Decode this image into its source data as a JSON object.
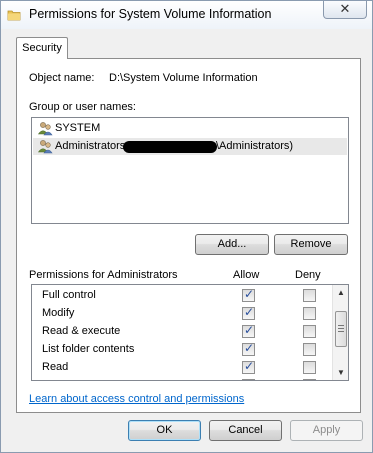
{
  "window": {
    "title": "Permissions for System Volume Information",
    "close_glyph": "✕"
  },
  "tabs": [
    {
      "label": "Security"
    }
  ],
  "object": {
    "label": "Object name:",
    "value": "D:\\System Volume Information"
  },
  "groups": {
    "label": "Group or user names:",
    "items": [
      {
        "name": "SYSTEM",
        "icon": "users-icon"
      },
      {
        "name": "Administrators (",
        "suffix": "\\Administrators)",
        "redacted": true,
        "icon": "users-icon"
      }
    ],
    "add_label": "Add...",
    "remove_label": "Remove"
  },
  "permissions": {
    "label": "Permissions for Administrators",
    "allow_label": "Allow",
    "deny_label": "Deny",
    "rows": [
      {
        "name": "Full control",
        "allow": true,
        "deny": false
      },
      {
        "name": "Modify",
        "allow": true,
        "deny": false
      },
      {
        "name": "Read & execute",
        "allow": true,
        "deny": false
      },
      {
        "name": "List folder contents",
        "allow": true,
        "deny": false
      },
      {
        "name": "Read",
        "allow": true,
        "deny": false
      }
    ]
  },
  "link": "Learn about access control and permissions",
  "buttons": {
    "ok": "OK",
    "cancel": "Cancel",
    "apply": "Apply"
  },
  "colors": {
    "link": "#0066cc",
    "selection": "#e8e8e8",
    "check": "#2a4f9c"
  }
}
